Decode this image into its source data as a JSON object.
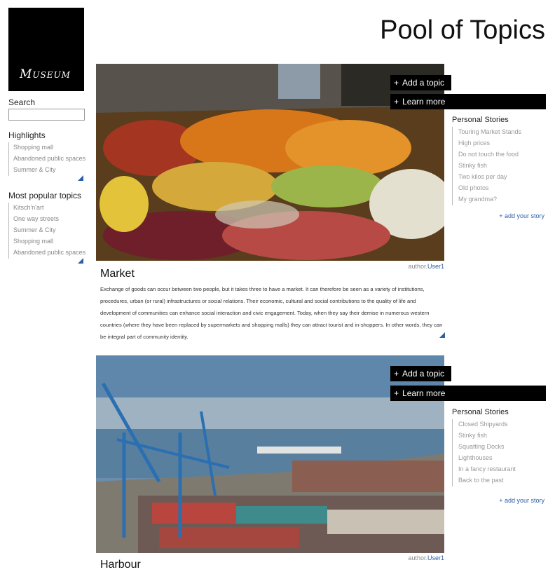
{
  "logo": {
    "text": "Museum"
  },
  "page_title": "Pool of Topics",
  "sidebar": {
    "search_label": "Search",
    "search_value": "",
    "highlights_label": "Highlights",
    "highlights": [
      "Shopping mall",
      "Abandoned public spaces",
      "Summer & City"
    ],
    "popular_label": "Most popular topics",
    "popular": [
      "Kitsch'n'art",
      "One way streets",
      "Summer & City",
      "Shopping mall",
      "Abandoned public spaces"
    ]
  },
  "actions": {
    "add_topic": "Add a topic",
    "learn_more": "Learn more",
    "plus": "+"
  },
  "topics": [
    {
      "title": "Market",
      "author_label": "author.",
      "author_name": "User1",
      "stories_title": "Personal Stories",
      "stories": [
        "Touring Market Stands",
        "High prices",
        "Do not touch the food",
        "Stinky fish",
        "Two kilos per day",
        "Old photos",
        "My grandma?"
      ],
      "add_story": "+ add your story",
      "description": "Exchange of goods can occur between two people, but it takes three to have a market. It can therefore be seen as a variety of institutions, procedures, urban (or rural) infrastructures or social relations. Their economic, cultural and social contributions to the quality of life and development of communities can enhance social interaction and civic engagement. Today, when they say their demise in numerous western countries (where they have been replaced by supermarkets and shopping malls) they can attract tourist and in-shoppers. In other words, they can be integral part of community identity."
    },
    {
      "title": "Harbour",
      "author_label": "author.",
      "author_name": "User1",
      "stories_title": "Personal Stories",
      "stories": [
        "Closed Shipyards",
        "Stinky fish",
        "Squatting Docks",
        "Lighthouses",
        "In a fancy restaurant",
        "Back to the past"
      ],
      "add_story": "+ add your story"
    }
  ]
}
